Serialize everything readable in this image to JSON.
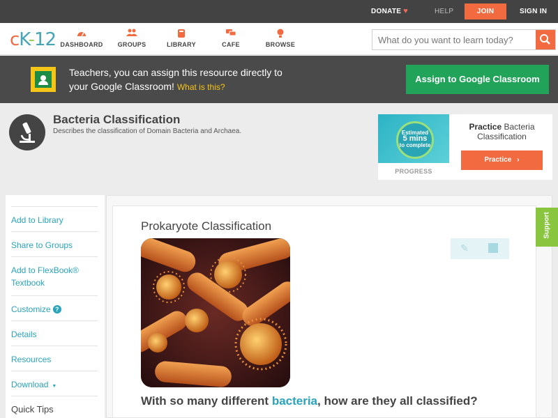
{
  "topbar": {
    "donate": "DONATE",
    "help": "HELP",
    "join": "JOIN",
    "signin": "SIGN IN"
  },
  "logo": {
    "c": "c",
    "k": "K",
    "dash": "-",
    "n12": "12"
  },
  "nav": {
    "items": [
      {
        "label": "DASHBOARD",
        "icon": "dashboard-icon"
      },
      {
        "label": "GROUPS",
        "icon": "groups-icon"
      },
      {
        "label": "LIBRARY",
        "icon": "library-icon"
      },
      {
        "label": "CAFE",
        "icon": "cafe-icon"
      },
      {
        "label": "BROWSE",
        "icon": "browse-icon"
      }
    ],
    "search_placeholder": "What do you want to learn today?"
  },
  "banner": {
    "line1": "Teachers, you can assign this resource directly to",
    "line2": "your Google Classroom!",
    "what": "What is this?",
    "assign": "Assign to Google Classroom"
  },
  "header": {
    "title": "Bacteria Classification",
    "subtitle": "Describes the classification of Domain Bacteria and Archaea."
  },
  "practice": {
    "estimated": "Estimated",
    "mins": "5 mins",
    "to_complete": "to complete",
    "progress": "PROGRESS",
    "title_bold": "Practice",
    "title_rest": "Bacteria Classification",
    "button": "Practice"
  },
  "sidebar": {
    "add_library": "Add to Library",
    "share_groups": "Share to Groups",
    "add_flexbook": "Add to FlexBook®",
    "textbook": "Textbook",
    "customize": "Customize",
    "details": "Details",
    "resources": "Resources",
    "download": "Download",
    "quick_tips": "Quick Tips"
  },
  "content": {
    "title": "Prokaryote Classification",
    "q_pre": "With so many different ",
    "q_hl": "bacteria",
    "q_post": ", how are they all classified?"
  },
  "support": "Support",
  "colors": {
    "accent": "#f26a3f",
    "teal": "#2aa3bd",
    "green": "#21a35a"
  }
}
